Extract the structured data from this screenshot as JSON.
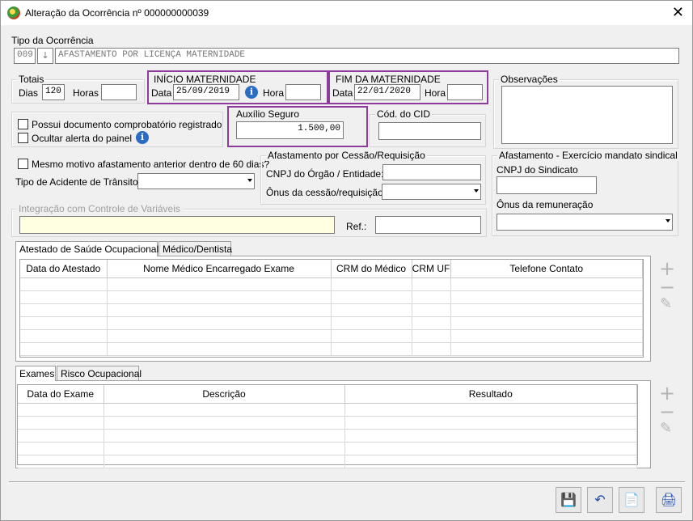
{
  "window": {
    "title": "Alteração da Ocorrência nº 000000000039",
    "close_label": "✕"
  },
  "tipo": {
    "label": "Tipo da Ocorrência",
    "code": "009",
    "lookup_label": "↓",
    "description": "AFASTAMENTO POR LICENÇA MATERNIDADE"
  },
  "totais": {
    "legend": "Totais",
    "dias_label": "Dias",
    "dias_value": "120",
    "horas_label": "Horas",
    "horas_value": ""
  },
  "inicio": {
    "legend": "INÍCIO MATERNIDADE",
    "data_label": "Data",
    "data_value": "25/09/2019",
    "hora_label": "Hora",
    "hora_value": ""
  },
  "fim": {
    "legend": "FIM DA MATERNIDADE",
    "data_label": "Data",
    "data_value": "22/01/2020",
    "hora_label": "Hora",
    "hora_value": ""
  },
  "observacoes": {
    "legend": "Observações",
    "value": ""
  },
  "checks": {
    "possui_doc": "Possui documento comprobatório registrado",
    "ocultar_alerta": "Ocultar alerta do painel",
    "mesmo_motivo": "Mesmo motivo afastamento anterior dentro de 60 dias?"
  },
  "auxilio": {
    "legend": "Auxílio Seguro",
    "value": "1.500,00"
  },
  "cid": {
    "legend": "Cód. do CID",
    "value": ""
  },
  "acidente": {
    "label": "Tipo de Acidente de Trânsito:",
    "value": ""
  },
  "cessao": {
    "legend": "Afastamento por Cessão/Requisição",
    "cnpj_label": "CNPJ do Órgão / Entidade:",
    "onus_label": "Ônus da cessão/requisição:"
  },
  "sindical": {
    "legend": "Afastamento - Exercício mandato sindical",
    "cnpj_label": "CNPJ do Sindicato",
    "onus_label": "Ônus da remuneração"
  },
  "integracao": {
    "legend": "Integração com Controle de Variáveis",
    "ref_label": "Ref.:"
  },
  "tabs1": [
    "Atestado de Saúde Ocupacional",
    "Médico/Dentista"
  ],
  "grid1": {
    "columns": [
      "Data do Atestado",
      "Nome Médico Encarregado Exame",
      "CRM do Médico",
      "CRM UF",
      "Telefone Contato"
    ]
  },
  "tabs2": [
    "Exames",
    "Risco Ocupacional"
  ],
  "grid2": {
    "columns": [
      "Data do Exame",
      "Descrição",
      "Resultado"
    ]
  },
  "icons": {
    "add": "plus-icon",
    "remove": "minus-icon",
    "edit": "pencil-icon",
    "save": "floppy-icon",
    "undo": "undo-icon",
    "report": "document-icon",
    "export": "export-icon"
  },
  "colors": {
    "highlight": "#8e3c9c",
    "integration_field": "#ffffe1"
  }
}
